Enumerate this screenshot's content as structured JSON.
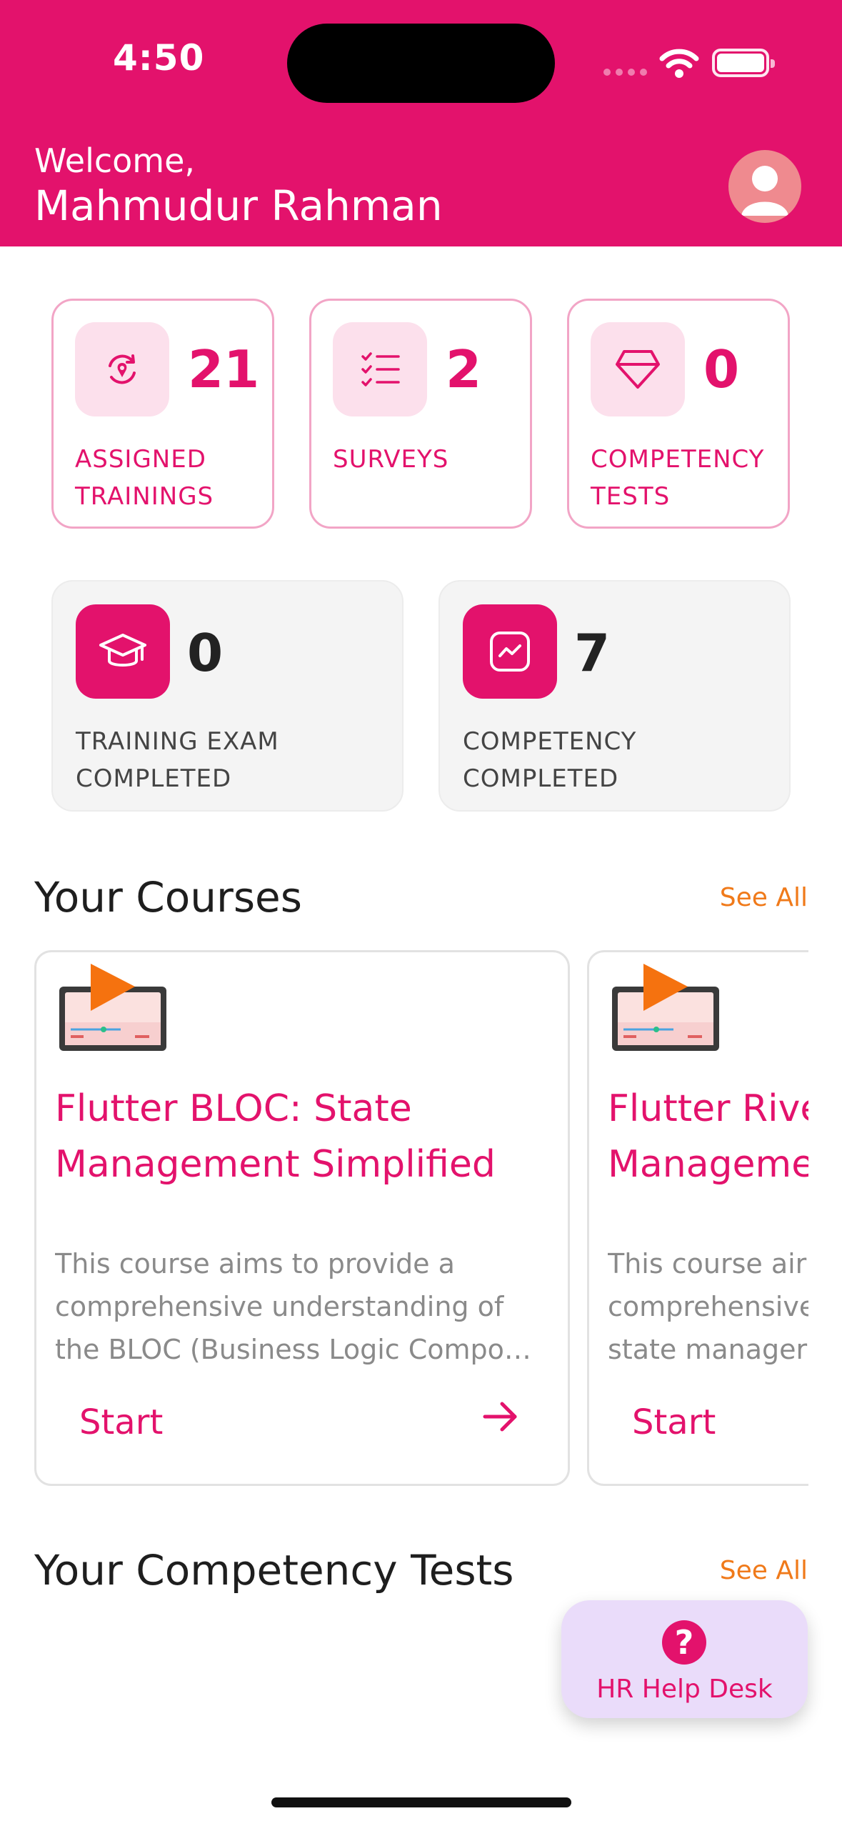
{
  "status_bar": {
    "time": "4:50"
  },
  "header": {
    "welcome": "Welcome,",
    "username": "Mahmudur Rahman"
  },
  "stats": [
    {
      "value": "21",
      "label_line1": "ASSIGNED",
      "label_line2": "TRAININGS",
      "icon": "training-refresh-icon"
    },
    {
      "value": "2",
      "label_line1": "SURVEYS",
      "label_line2": "",
      "icon": "checklist-icon"
    },
    {
      "value": "0",
      "label_line1": "COMPETENCY",
      "label_line2": "TESTS",
      "icon": "gem-icon"
    }
  ],
  "completed": [
    {
      "value": "0",
      "label_line1": "TRAINING EXAM",
      "label_line2": "COMPLETED",
      "icon": "graduation-cap-icon"
    },
    {
      "value": "7",
      "label_line1": "COMPETENCY",
      "label_line2": "COMPLETED",
      "icon": "trend-chart-icon"
    }
  ],
  "courses_section": {
    "title": "Your Courses",
    "see_all": "See All"
  },
  "courses": [
    {
      "title_line1": "Flutter BLOC: State",
      "title_line2": "Management Simplified",
      "desc_line1": "This course aims to provide a",
      "desc_line2": "comprehensive understanding of",
      "desc_line3": "the BLOC (Business Logic Compo…",
      "start": "Start"
    },
    {
      "title_line1": "Flutter Rive",
      "title_line2": "Manageme",
      "desc_line1": "This course air",
      "desc_line2": "comprehensive",
      "desc_line3": "state manager",
      "start": "Start"
    }
  ],
  "competency_section": {
    "title": "Your Competency Tests",
    "see_all": "See All"
  },
  "help_desk": {
    "label": "HR Help Desk",
    "icon_glyph": "?"
  },
  "colors": {
    "brand": "#e3126c",
    "accent_orange": "#f07a1a",
    "help_bg": "#eadcfa"
  }
}
